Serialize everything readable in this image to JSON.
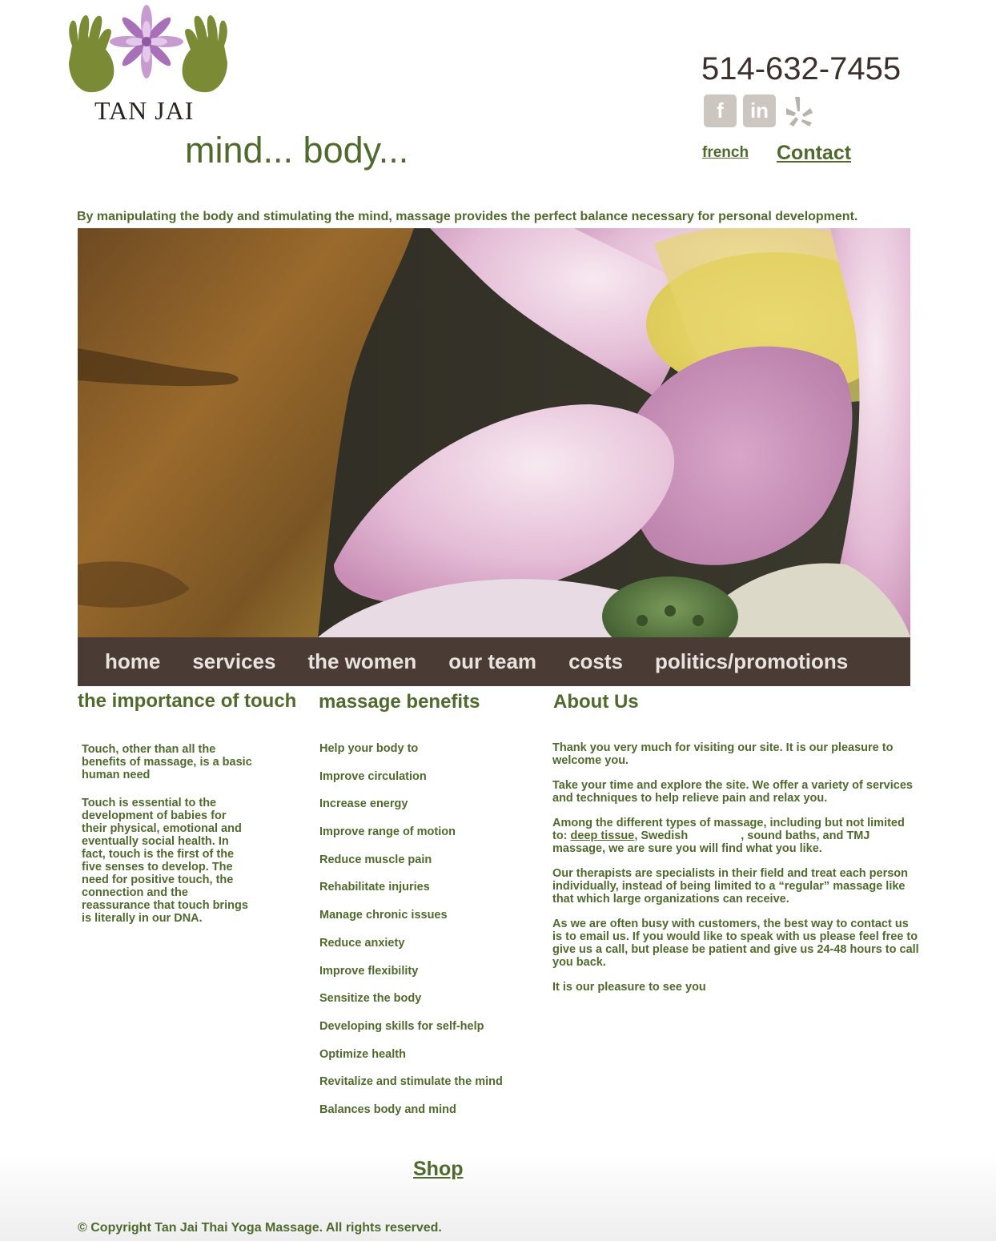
{
  "brand": {
    "logo_text": "TAN JAI",
    "tagline": "mind... body..."
  },
  "header": {
    "phone": "514-632-7455",
    "social": [
      {
        "icon": "facebook-icon",
        "glyph": "f"
      },
      {
        "icon": "linkedin-icon",
        "glyph": "in"
      },
      {
        "icon": "yelp-icon",
        "glyph": ""
      }
    ],
    "lang_link": "french",
    "contact_link": "Contact"
  },
  "intro": "By manipulating the body and stimulating the mind, massage provides the perfect balance necessary for personal development.",
  "nav": {
    "items": [
      "home",
      "services",
      "the women",
      "our team",
      "costs",
      "politics/promotions"
    ]
  },
  "touch": {
    "title": "the importance of touch",
    "p1": "Touch, other than all the benefits of massage, is a basic human need",
    "p2": "Touch is essential to the development of babies for their physical, emotional and eventually social health. In fact, touch is the first of the five senses to develop. The need for positive touch, the connection and the reassurance that touch brings is literally in our DNA."
  },
  "benefits": {
    "title": "massage benefits",
    "items": [
      "Help your body to",
      "Improve circulation",
      "Increase energy",
      "Improve range of motion",
      "Reduce muscle pain",
      "Rehabilitate injuries",
      "Manage chronic issues",
      "Reduce anxiety",
      "Improve flexibility",
      "Sensitize the body",
      "Developing skills for self-help",
      "Optimize health",
      "Revitalize and stimulate the mind",
      "Balances body and mind"
    ]
  },
  "about": {
    "title": "About Us",
    "p1": "Thank you very much for visiting our site. It is our pleasure to welcome you.",
    "p2": "Take your time and explore the site. We offer a variety of services and techniques to help relieve pain and relax you.",
    "p3_before": "Among the different types of massage, including but not limited to: ",
    "p3_link": "deep tissue",
    "p3_mid": ", Swedish",
    "p3_after": ", sound baths, and TMJ massage, we are sure you will find what you like.",
    "p4": "Our therapists are specialists in their field and treat each person individually, instead of being limited to a “regular” massage like that which large organizations can receive.",
    "p5": "As we are often busy with customers, the best way to contact us is to email us. If you would like to speak with us please feel free to give us a call, but please be patient and give us 24-48 hours to call you back.",
    "p6": "It is our pleasure to see you"
  },
  "footer": {
    "shop_link": "Shop",
    "copyright": "© Copyright Tan Jai Thai Yoga Massage. All rights reserved."
  },
  "colors": {
    "brand_green": "#4f6a2c",
    "nav_bg": "#4a3b35",
    "phone": "#3b302b"
  }
}
